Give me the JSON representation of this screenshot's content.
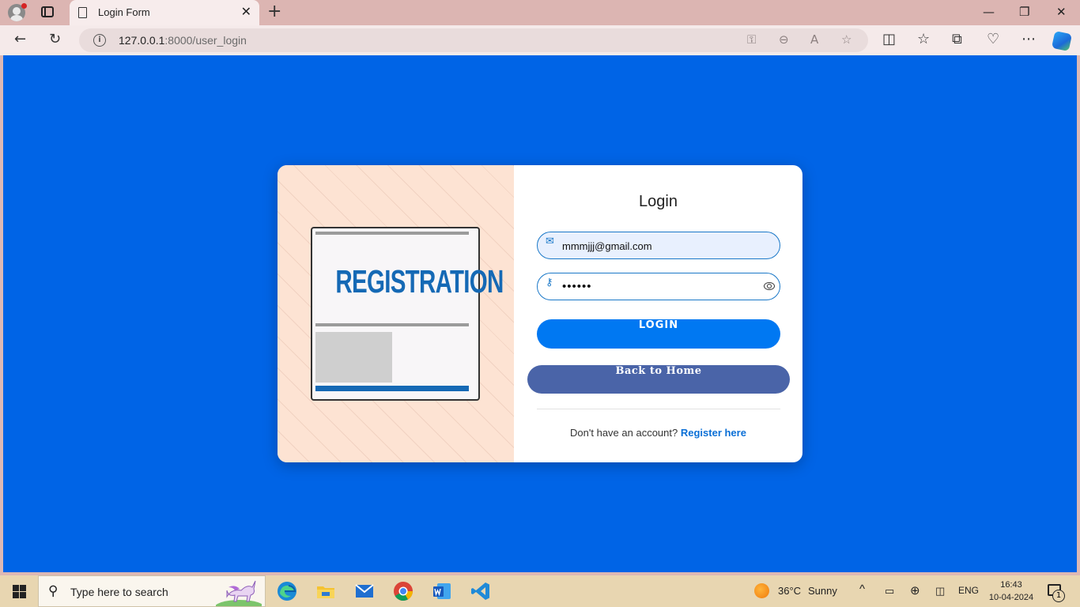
{
  "browser": {
    "tab_title": "Login Form",
    "url_host": "127.0.0.1",
    "url_path": ":8000/user_login"
  },
  "illustration": {
    "title": "REGISTRATION"
  },
  "login_form": {
    "title": "Login",
    "email_value": "mmmjjj@gmail.com",
    "password_mask": "••••••",
    "login_button": "LOGIN",
    "home_button": "Back to Home",
    "register_prompt": "Don't have an account?",
    "register_link": "Register here"
  },
  "colors": {
    "page_background": "#0064e6",
    "login_button": "#0078f2",
    "home_button": "#4a64a8",
    "illustration_background": "#fde3d3",
    "illustration_accent": "#1569b5"
  },
  "taskbar": {
    "search_placeholder": "Type here to search",
    "temperature": "36°C",
    "weather": "Sunny",
    "language": "ENG",
    "time": "16:43",
    "date": "10-04-2024",
    "notification_count": "1",
    "apps": [
      "edge-icon",
      "file-explorer-icon",
      "mail-icon",
      "chrome-icon",
      "word-icon",
      "vscode-icon"
    ]
  }
}
